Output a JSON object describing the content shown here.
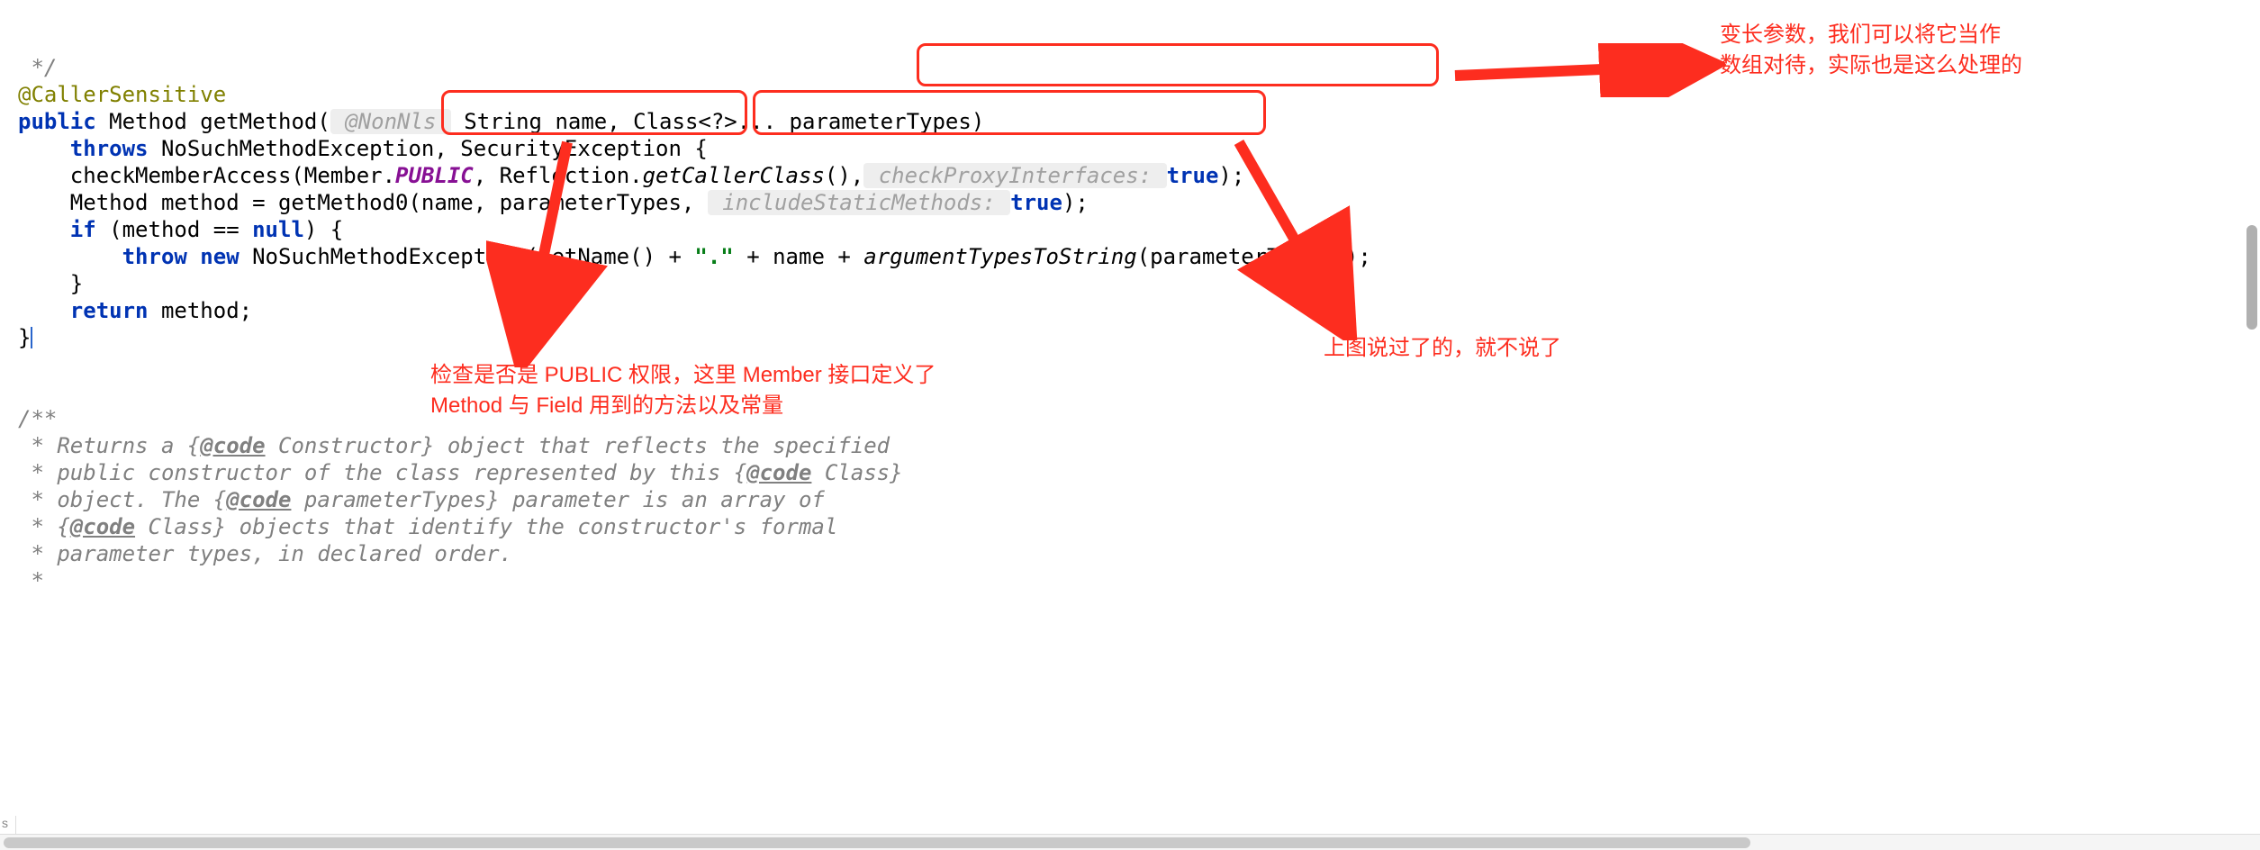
{
  "code": {
    "comment_end": " */",
    "annotation": "@CallerSensitive",
    "kw_public": "public",
    "type_Method": " Method ",
    "m_getMethod": "getMethod(",
    "hint_NonNls": " @NonNls ",
    "p_String": " String name, ",
    "p_Class": "Class<?>... parameterTypes",
    "paren_close": ")",
    "kw_throws": "throws",
    "exc": " NoSuchMethodException, SecurityException {",
    "call_cma": "    checkMemberAccess(",
    "member": "Member.",
    "PUBLIC": "PUBLIC",
    "comma": ", ",
    "refl": "Reflection.",
    "gcc": "getCallerClass",
    "refl_close": "(),",
    "hint_cpi": " checkProxyInterfaces: ",
    "kw_true": "true",
    "close_stmt": ");",
    "l_method_decl": "    Method method = getMethod0(name, parameterTypes, ",
    "hint_ism": " includeStaticMethods: ",
    "kw_if": "if",
    "if_cond": " (method == ",
    "kw_null": "null",
    "if_close": ") {",
    "kw_throw": "throw",
    "kw_new": "new",
    "nsme": " NoSuchMethodException(getName() + ",
    "str_dot": "\".\"",
    "plus_name": " + name + ",
    "attts": "argumentTypesToString",
    "attts_close": "(parameterTypes));",
    "brace_close": "    }",
    "kw_return": "return",
    "ret_method": " method;",
    "final_brace": "}",
    "jd1": "/**",
    "jd2": " * Returns a {",
    "jd_code": "@code",
    "jd2b": " Constructor} object that reflects the specified",
    "jd3": " * public constructor of the class represented by this {",
    "jd3b": " Class}",
    "jd4": " * object. The {",
    "jd4b": " parameterTypes} parameter is an array of",
    "jd5": " * {",
    "jd5b": " Class} objects that identify the constructor's formal",
    "jd6": " * parameter types, in declared order.",
    "jd7": " *"
  },
  "annotations": {
    "vararg": "变长参数，我们可以将它当作\n数组对待，实际也是这么处理的",
    "public_note": "检查是否是 PUBLIC 权限，这里 Member 接口定义了\nMethod 与 Field 用到的方法以及常量",
    "said_above": "上图说过了的，就不说了"
  },
  "status": {
    "tab": "s"
  }
}
